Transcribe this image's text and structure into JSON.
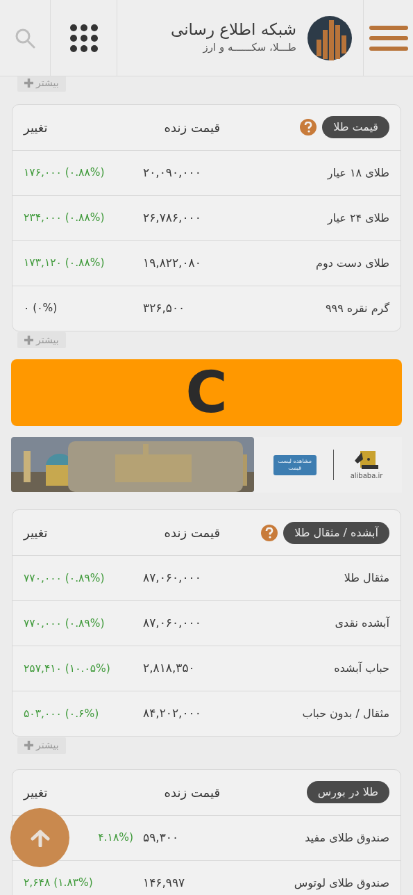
{
  "header": {
    "title": "شبکه اطلاع رسانی",
    "subtitle": "طـــلا، سکــــــه و ارز"
  },
  "more_top": {
    "label": "بیشتر"
  },
  "sections": [
    {
      "title": "قیمت طلا",
      "help": true,
      "columns": [
        "قیمت زنده",
        "تغییر"
      ],
      "more": "بیشتر",
      "rows": [
        {
          "name": "طلای ۱۸ عیار",
          "price": "۲۰,۰۹۰,۰۰۰",
          "change": "۱۷۶,۰۰۰ (۰.۸۸%)",
          "kind": "up"
        },
        {
          "name": "طلای ۲۴ عیار",
          "price": "۲۶,۷۸۶,۰۰۰",
          "change": "۲۳۴,۰۰۰ (۰.۸۸%)",
          "kind": "up"
        },
        {
          "name": "طلای دست دوم",
          "price": "۱۹,۸۲۲,۰۸۰",
          "change": "۱۷۳,۱۲۰ (۰.۸۸%)",
          "kind": "up"
        },
        {
          "name": "گرم نقره ۹۹۹",
          "price": "۳۲۶,۵۰۰",
          "change": "۰ (۰%)",
          "kind": "flat"
        }
      ]
    },
    {
      "title": "آبشده / مثقال طلا",
      "help": true,
      "columns": [
        "قیمت زنده",
        "تغییر"
      ],
      "more": "بیشتر",
      "rows": [
        {
          "name": "مثقال طلا",
          "price": "۸۷,۰۶۰,۰۰۰",
          "change": "۷۷۰,۰۰۰ (۰.۸۹%)",
          "kind": "up"
        },
        {
          "name": "آبشده نقدی",
          "price": "۸۷,۰۶۰,۰۰۰",
          "change": "۷۷۰,۰۰۰ (۰.۸۹%)",
          "kind": "up"
        },
        {
          "name": "حباب آبشده",
          "price": "۲,۸۱۸,۳۵۰",
          "change": "۲۵۷,۴۱۰ (۱۰.۰۵%)",
          "kind": "up"
        },
        {
          "name": "مثقال / بدون حباب",
          "price": "۸۴,۲۰۲,۰۰۰",
          "change": "۵۰۳,۰۰۰ (۰.۶%)",
          "kind": "up"
        }
      ]
    },
    {
      "title": "طلا در بورس",
      "help": false,
      "columns": [
        "قیمت زنده",
        "تغییر"
      ],
      "rows": [
        {
          "name": "صندوق طلای مفید",
          "price": "۵۹,۳۰۰",
          "change": "۴.۱۸%)",
          "kind": "up"
        },
        {
          "name": "صندوق طلای لوتوس",
          "price": "۱۴۶,۹۹۷",
          "change": "۲,۶۴۸ (۱.۸۳%)",
          "kind": "up"
        }
      ]
    }
  ],
  "banner": {
    "letter": "C"
  },
  "ad": {
    "kind": "picture",
    "button": "مشاهده لیست قیمت",
    "brand": "alibaba.ir"
  }
}
